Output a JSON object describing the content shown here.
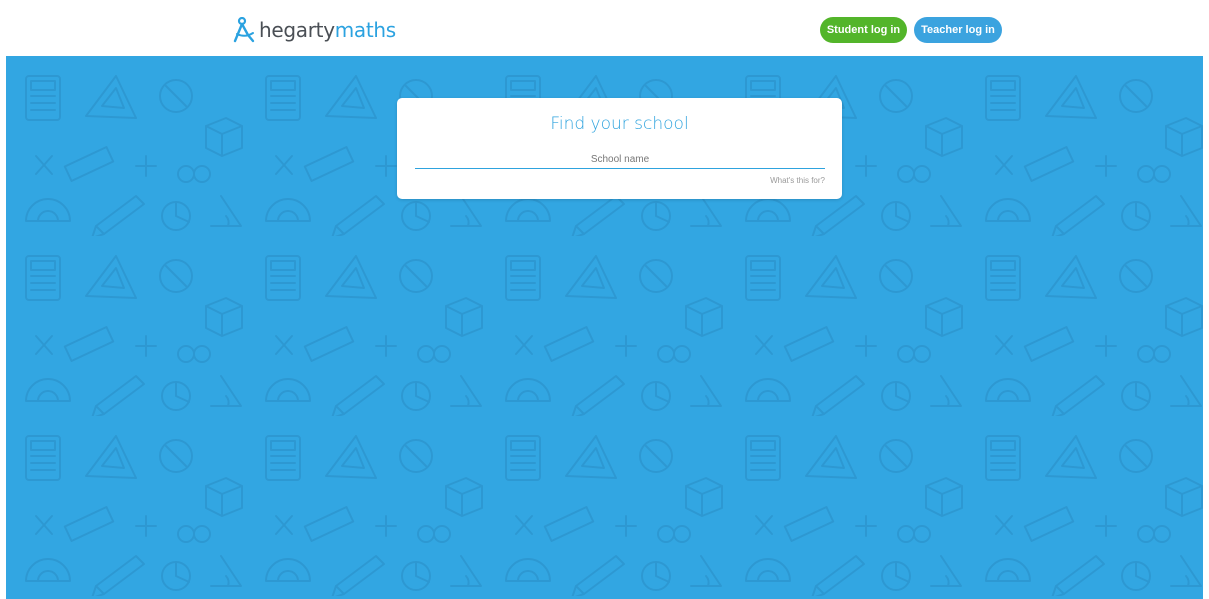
{
  "header": {
    "logo": {
      "text_part1": "hegarty",
      "text_part2": "maths",
      "icon": "compass-icon"
    },
    "student_login_label": "Student log in",
    "teacher_login_label": "Teacher log in"
  },
  "search_card": {
    "title": "Find your school",
    "input_placeholder": "School name",
    "input_value": "",
    "help_link": "What's this for?"
  },
  "colors": {
    "brand_blue": "#2ba2e0",
    "background_blue": "#32a6e2",
    "student_green": "#53b52a",
    "teacher_blue": "#3ba3df",
    "logo_grey": "#4a4f55"
  }
}
